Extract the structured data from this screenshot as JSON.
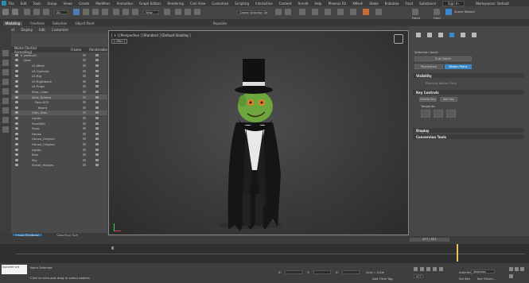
{
  "menubar": {
    "items": [
      "File",
      "Edit",
      "Tools",
      "Group",
      "Views",
      "Create",
      "Modifiers",
      "Animation",
      "Graph Editors",
      "Rendering",
      "Civil View",
      "Customize",
      "Scripting",
      "Interactive",
      "Content",
      "Arnold",
      "Help",
      "Phoenix FD",
      "XMesh",
      "Stoke",
      "Krakatoa",
      "Frost",
      "Substance"
    ],
    "signin": "Sign In",
    "workspaces_label": "Workspaces:",
    "workspace_value": "Default"
  },
  "toolbar": {
    "selection_filter": "All",
    "create_selection_set": "Create Selection Se",
    "view_label": "View",
    "scene_wizard": "Scene Wizard",
    "fetch_label": "Fetch",
    "hold_label": "Hold"
  },
  "ribbon": {
    "tabs": [
      "Modeling",
      "Freeform",
      "Selection",
      "Object Paint"
    ],
    "populate": "Populate"
  },
  "scene_explorer": {
    "tabs": [
      "Select",
      "Display",
      "Edit",
      "Customize"
    ],
    "col_name": "Name (Sorted Ascending)",
    "col_frozen": "Frozen",
    "col_renderable": "Renderable",
    "rows": [
      {
        "label": "0 (default)",
        "indent": 26
      },
      {
        "label": "Drac",
        "indent": 30
      },
      {
        "label": "LE-Mesh",
        "indent": 40
      },
      {
        "label": "LE-Controls",
        "indent": 40
      },
      {
        "label": "LE-Rig",
        "indent": 40
      },
      {
        "label": "LE-Rightback",
        "indent": 40
      },
      {
        "label": "LE-Props",
        "indent": 40
      },
      {
        "label": "Drac_Cape",
        "indent": 40
      },
      {
        "label": "Drac_Sphere",
        "indent": 40
      },
      {
        "label": "Face.003",
        "indent": 44
      },
      {
        "label": "Beard",
        "indent": 48
      },
      {
        "label": "Cam_Drac",
        "indent": 40
      },
      {
        "label": "Lights",
        "indent": 40
      },
      {
        "label": "Front000",
        "indent": 40
      },
      {
        "label": "Floor",
        "indent": 40
      },
      {
        "label": "House",
        "indent": 40
      },
      {
        "label": "House_Original",
        "indent": 40
      },
      {
        "label": "House_Original",
        "indent": 40
      },
      {
        "label": "Lights",
        "indent": 40
      },
      {
        "label": "Rain",
        "indent": 40
      },
      {
        "label": "Sky",
        "indent": 40
      },
      {
        "label": "Street_Houses",
        "indent": 40
      }
    ],
    "layer_explorer": "Layer Explorer",
    "selection_set_label": "Selection Set:"
  },
  "viewport": {
    "label": "[ + ] [Perspective ] [Standard ] [Default Shading ]",
    "tag": "[ vRev ]"
  },
  "command_panel": {
    "selection_level": "Selection Level:",
    "sub_object": "Sub-Object",
    "parameters": "Parameters",
    "motion_paths": "Motion Paths",
    "visibility": "Visibility",
    "remove_motion": "Remove Motion Path",
    "key_controls": "Key Controls",
    "delete_key": "Delete Key",
    "add_key": "Add Key",
    "tangents": "Tangents:",
    "display": "Display",
    "conversion_tools": "Conversion Tools"
  },
  "timeline": {
    "slider": "477 / 551",
    "progress": 0.866
  },
  "statusbar": {
    "maxscript": "SyncVerlet",
    "status": "None Selected",
    "prompt": "Click or click-and-drag to select objects",
    "x_label": "X:",
    "y_label": "Y:",
    "z_label": "Z:",
    "grid": "Grid = 0.0m",
    "add_time_tag": "Add Time Tag",
    "frame": "477",
    "autokey": "Auto Key",
    "setkey": "Set Key",
    "selected": "Selected",
    "key_filters": "Key Filters..."
  }
}
